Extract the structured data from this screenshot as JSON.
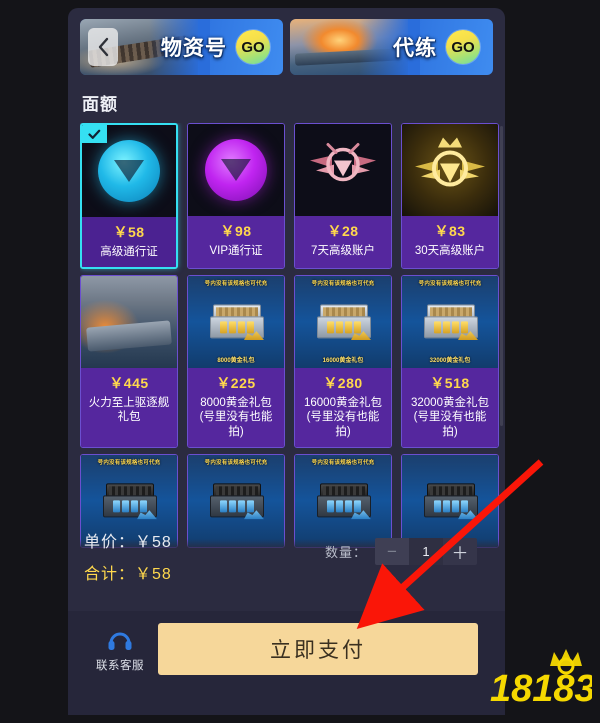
{
  "banners": [
    {
      "label": "物资号",
      "go": "GO",
      "art": "warship-supply"
    },
    {
      "label": "代练",
      "go": "GO",
      "art": "warship-burning"
    }
  ],
  "back_icon": "chevron-left-icon",
  "section": {
    "title": "面额"
  },
  "products": [
    {
      "price": "￥58",
      "name": "高级通行证",
      "art": "emblem-cyan",
      "selected": true,
      "badge": "check-icon"
    },
    {
      "price": "￥98",
      "name": "VIP通行证",
      "art": "emblem-purple",
      "selected": false
    },
    {
      "price": "￥28",
      "name": "7天高级账户",
      "art": "emblem-rose",
      "selected": false
    },
    {
      "price": "￥83",
      "name": "30天高级账户",
      "art": "emblem-gold",
      "selected": false
    },
    {
      "price": "￥445",
      "name": "火力至上驱逐舰礼包",
      "art": "ship",
      "selected": false
    },
    {
      "price": "￥225",
      "name": "8000黄金礼包 (号里没有也能拍)",
      "art": "giftbox-gold",
      "selected": false,
      "art_top": "号内没有该规格也可代充",
      "art_bottom": "8000黄金礼包"
    },
    {
      "price": "￥280",
      "name": "16000黄金礼包 (号里没有也能拍)",
      "art": "giftbox-gold",
      "selected": false,
      "art_top": "号内没有该规格也可代充",
      "art_bottom": "16000黄金礼包"
    },
    {
      "price": "￥518",
      "name": "32000黄金礼包 (号里没有也能拍)",
      "art": "giftbox-gold",
      "selected": false,
      "art_top": "号内没有该规格也可代充",
      "art_bottom": "32000黄金礼包"
    },
    {
      "price": "",
      "name": "",
      "art": "giftbox-blue",
      "selected": false,
      "art_top": "号内没有该规格也可代充"
    },
    {
      "price": "",
      "name": "",
      "art": "giftbox-blue",
      "selected": false,
      "art_top": "号内没有该规格也可代充"
    },
    {
      "price": "",
      "name": "",
      "art": "giftbox-blue",
      "selected": false,
      "art_top": "号内没有该规格也可代充"
    },
    {
      "price": "",
      "name": "",
      "art": "giftbox-blue",
      "selected": false,
      "art_top": ""
    }
  ],
  "summary": {
    "unit_label": "单价：",
    "unit_value": "￥58",
    "total_label": "合计：",
    "total_value": "￥58",
    "qty_label": "数量：",
    "qty_minus": "−",
    "qty_value": "1",
    "qty_plus": "＋"
  },
  "paybar": {
    "support_label": "联系客服",
    "support_icon": "headset-icon",
    "pay_label": "立即支付"
  },
  "watermark": {
    "text": "18183"
  },
  "colors": {
    "accent_cyan": "#35e0f2",
    "card_purple": "#55279e",
    "price_gold": "#ffd84d",
    "pay_button": "#f6d79a",
    "panel_bg": "#2b2b40",
    "page_bg": "#141418",
    "arrow_red": "#fa1608"
  }
}
